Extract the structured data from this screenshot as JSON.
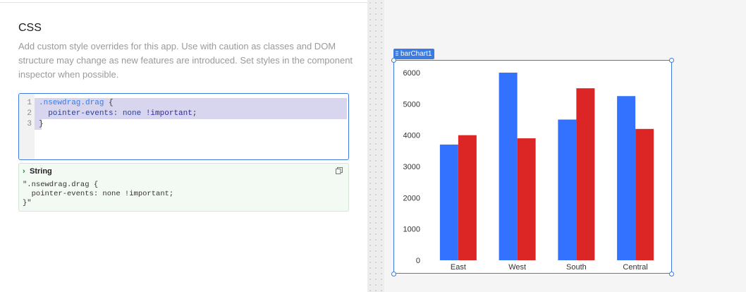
{
  "css_panel": {
    "title": "CSS",
    "description": "Add custom style overrides for this app. Use with caution as classes and DOM structure may change as new features are introduced. Set styles in the component inspector when possible.",
    "editor": {
      "lines": [
        {
          "number": "1",
          "selector": ".nsewdrag.drag",
          "rest": " {"
        },
        {
          "number": "2",
          "property": "  pointer-events:",
          "value": " none",
          "important": " !important",
          "end": ";"
        },
        {
          "number": "3",
          "rest": "}"
        }
      ]
    },
    "result": {
      "type_label": "String",
      "value": "\".nsewdrag.drag {\n  pointer-events: none !important;\n}\"",
      "icons": {
        "expand": "chevron-right-icon",
        "copy": "copy-icon"
      }
    }
  },
  "component": {
    "name": "barChart1"
  },
  "colors": {
    "accent": "#3b7be2",
    "series_1": "#3371ff",
    "series_2": "#dc2626"
  },
  "chart_data": {
    "type": "bar",
    "categories": [
      "East",
      "West",
      "South",
      "Central"
    ],
    "series": [
      {
        "values": [
          3700,
          6000,
          4500,
          5250
        ]
      },
      {
        "values": [
          4000,
          3900,
          5500,
          4200
        ]
      }
    ],
    "ylim": [
      0,
      6000
    ],
    "yticks": [
      "0",
      "1000",
      "2000",
      "3000",
      "4000",
      "5000",
      "6000"
    ],
    "grid": false,
    "legend": false
  }
}
